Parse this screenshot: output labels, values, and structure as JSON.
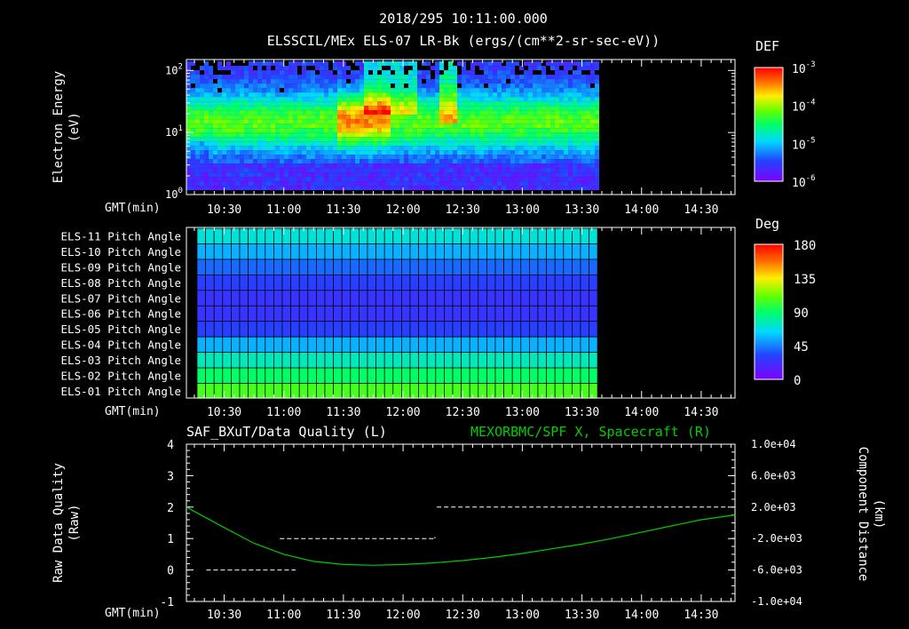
{
  "title_line1": "2018/295 10:11:00.000",
  "title_line2": "ELSSCIL/MEx ELS-07 LR-Bk  (ergs/(cm**2-sr-sec-eV))",
  "time_label": "GMT(min)",
  "time_ticks": [
    "10:30",
    "11:00",
    "11:30",
    "12:00",
    "12:30",
    "13:00",
    "13:30",
    "14:00",
    "14:30"
  ],
  "chart_data": [
    {
      "type": "heatmap",
      "ylabel": [
        "Electron Energy",
        "(eV)"
      ],
      "yscale": "log",
      "ylim": [
        1,
        150
      ],
      "y_ticks": [
        "10",
        "10",
        "10"
      ],
      "y_tick_exps": [
        "2",
        "1",
        "0"
      ],
      "data_end_time": "13:38",
      "colorbar": {
        "label": "DEF",
        "tick_base": [
          "10",
          "10",
          "10",
          "10"
        ],
        "tick_exps": [
          "-3",
          "-4",
          "-5",
          "-6"
        ],
        "range": [
          1e-06,
          0.001
        ]
      },
      "features": [
        {
          "time_range": [
            "11:35",
            "11:45"
          ],
          "description_level": "peak flux ~1e-4 near 20 eV"
        }
      ]
    },
    {
      "type": "heatmap",
      "rows": [
        "ELS-11 Pitch Angle",
        "ELS-10 Pitch Angle",
        "ELS-09 Pitch Angle",
        "ELS-08 Pitch Angle",
        "ELS-07 Pitch Angle",
        "ELS-06 Pitch Angle",
        "ELS-05 Pitch Angle",
        "ELS-04 Pitch Angle",
        "ELS-03 Pitch Angle",
        "ELS-02 Pitch Angle",
        "ELS-01 Pitch Angle"
      ],
      "row_values_deg": [
        70,
        55,
        40,
        30,
        25,
        25,
        30,
        55,
        75,
        90,
        105
      ],
      "data_end_time": "13:38",
      "colorbar": {
        "label": "Deg",
        "ticks": [
          "180",
          "135",
          "90",
          "45",
          "0"
        ],
        "range": [
          0,
          180
        ]
      }
    },
    {
      "type": "line",
      "title_left": "SAF_BXuT/Data Quality (L)",
      "title_right": "MEXORBMC/SPF X, Spacecraft (R)",
      "ylabel_left": [
        "Raw Data Quality",
        "(Raw)"
      ],
      "ylabel_right": [
        "Component Distance",
        "(km)"
      ],
      "left_ticks": [
        "4",
        "3",
        "2",
        "1",
        "0",
        "-1"
      ],
      "right_ticks": [
        "1.0e+04",
        "6.0e+03",
        "2.0e+03",
        "-2.0e+03",
        "-6.0e+03",
        "-1.0e+04"
      ],
      "ylim_left": [
        -1,
        4
      ],
      "ylim_right": [
        -10000,
        10000
      ],
      "series": [
        {
          "axis": "left",
          "color": "#ffffff",
          "dashed": true,
          "segments": [
            {
              "x": [
                "10:21",
                "11:06"
              ],
              "y": 0
            },
            {
              "x": [
                "10:58",
                "12:16"
              ],
              "y": 1
            },
            {
              "x": [
                "12:17",
                "14:44"
              ],
              "y": 2
            }
          ]
        },
        {
          "axis": "right",
          "color": "#00cc00",
          "x": [
            "10:11",
            "10:30",
            "10:45",
            "11:00",
            "11:15",
            "11:30",
            "11:45",
            "12:00",
            "12:15",
            "12:30",
            "12:45",
            "13:00",
            "13:15",
            "13:30",
            "13:45",
            "14:00",
            "14:15",
            "14:30",
            "14:47"
          ],
          "y": [
            2000,
            -600,
            -2600,
            -4000,
            -4900,
            -5300,
            -5400,
            -5300,
            -5100,
            -4800,
            -4400,
            -3900,
            -3300,
            -2700,
            -2000,
            -1200,
            -400,
            400,
            1000
          ]
        }
      ]
    }
  ]
}
